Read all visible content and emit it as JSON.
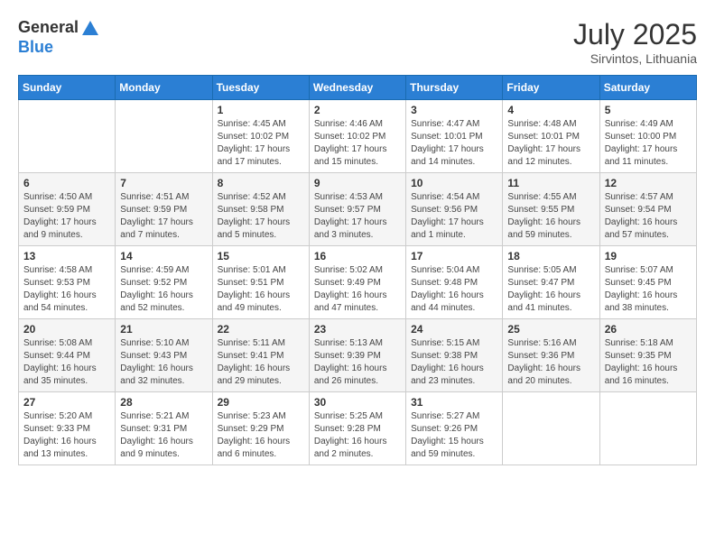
{
  "header": {
    "logo_general": "General",
    "logo_blue": "Blue",
    "month_title": "July 2025",
    "location": "Sirvintos, Lithuania"
  },
  "weekdays": [
    "Sunday",
    "Monday",
    "Tuesday",
    "Wednesday",
    "Thursday",
    "Friday",
    "Saturday"
  ],
  "weeks": [
    [
      {
        "day": "",
        "sunrise": "",
        "sunset": "",
        "daylight": ""
      },
      {
        "day": "",
        "sunrise": "",
        "sunset": "",
        "daylight": ""
      },
      {
        "day": "1",
        "sunrise": "Sunrise: 4:45 AM",
        "sunset": "Sunset: 10:02 PM",
        "daylight": "Daylight: 17 hours and 17 minutes."
      },
      {
        "day": "2",
        "sunrise": "Sunrise: 4:46 AM",
        "sunset": "Sunset: 10:02 PM",
        "daylight": "Daylight: 17 hours and 15 minutes."
      },
      {
        "day": "3",
        "sunrise": "Sunrise: 4:47 AM",
        "sunset": "Sunset: 10:01 PM",
        "daylight": "Daylight: 17 hours and 14 minutes."
      },
      {
        "day": "4",
        "sunrise": "Sunrise: 4:48 AM",
        "sunset": "Sunset: 10:01 PM",
        "daylight": "Daylight: 17 hours and 12 minutes."
      },
      {
        "day": "5",
        "sunrise": "Sunrise: 4:49 AM",
        "sunset": "Sunset: 10:00 PM",
        "daylight": "Daylight: 17 hours and 11 minutes."
      }
    ],
    [
      {
        "day": "6",
        "sunrise": "Sunrise: 4:50 AM",
        "sunset": "Sunset: 9:59 PM",
        "daylight": "Daylight: 17 hours and 9 minutes."
      },
      {
        "day": "7",
        "sunrise": "Sunrise: 4:51 AM",
        "sunset": "Sunset: 9:59 PM",
        "daylight": "Daylight: 17 hours and 7 minutes."
      },
      {
        "day": "8",
        "sunrise": "Sunrise: 4:52 AM",
        "sunset": "Sunset: 9:58 PM",
        "daylight": "Daylight: 17 hours and 5 minutes."
      },
      {
        "day": "9",
        "sunrise": "Sunrise: 4:53 AM",
        "sunset": "Sunset: 9:57 PM",
        "daylight": "Daylight: 17 hours and 3 minutes."
      },
      {
        "day": "10",
        "sunrise": "Sunrise: 4:54 AM",
        "sunset": "Sunset: 9:56 PM",
        "daylight": "Daylight: 17 hours and 1 minute."
      },
      {
        "day": "11",
        "sunrise": "Sunrise: 4:55 AM",
        "sunset": "Sunset: 9:55 PM",
        "daylight": "Daylight: 16 hours and 59 minutes."
      },
      {
        "day": "12",
        "sunrise": "Sunrise: 4:57 AM",
        "sunset": "Sunset: 9:54 PM",
        "daylight": "Daylight: 16 hours and 57 minutes."
      }
    ],
    [
      {
        "day": "13",
        "sunrise": "Sunrise: 4:58 AM",
        "sunset": "Sunset: 9:53 PM",
        "daylight": "Daylight: 16 hours and 54 minutes."
      },
      {
        "day": "14",
        "sunrise": "Sunrise: 4:59 AM",
        "sunset": "Sunset: 9:52 PM",
        "daylight": "Daylight: 16 hours and 52 minutes."
      },
      {
        "day": "15",
        "sunrise": "Sunrise: 5:01 AM",
        "sunset": "Sunset: 9:51 PM",
        "daylight": "Daylight: 16 hours and 49 minutes."
      },
      {
        "day": "16",
        "sunrise": "Sunrise: 5:02 AM",
        "sunset": "Sunset: 9:49 PM",
        "daylight": "Daylight: 16 hours and 47 minutes."
      },
      {
        "day": "17",
        "sunrise": "Sunrise: 5:04 AM",
        "sunset": "Sunset: 9:48 PM",
        "daylight": "Daylight: 16 hours and 44 minutes."
      },
      {
        "day": "18",
        "sunrise": "Sunrise: 5:05 AM",
        "sunset": "Sunset: 9:47 PM",
        "daylight": "Daylight: 16 hours and 41 minutes."
      },
      {
        "day": "19",
        "sunrise": "Sunrise: 5:07 AM",
        "sunset": "Sunset: 9:45 PM",
        "daylight": "Daylight: 16 hours and 38 minutes."
      }
    ],
    [
      {
        "day": "20",
        "sunrise": "Sunrise: 5:08 AM",
        "sunset": "Sunset: 9:44 PM",
        "daylight": "Daylight: 16 hours and 35 minutes."
      },
      {
        "day": "21",
        "sunrise": "Sunrise: 5:10 AM",
        "sunset": "Sunset: 9:43 PM",
        "daylight": "Daylight: 16 hours and 32 minutes."
      },
      {
        "day": "22",
        "sunrise": "Sunrise: 5:11 AM",
        "sunset": "Sunset: 9:41 PM",
        "daylight": "Daylight: 16 hours and 29 minutes."
      },
      {
        "day": "23",
        "sunrise": "Sunrise: 5:13 AM",
        "sunset": "Sunset: 9:39 PM",
        "daylight": "Daylight: 16 hours and 26 minutes."
      },
      {
        "day": "24",
        "sunrise": "Sunrise: 5:15 AM",
        "sunset": "Sunset: 9:38 PM",
        "daylight": "Daylight: 16 hours and 23 minutes."
      },
      {
        "day": "25",
        "sunrise": "Sunrise: 5:16 AM",
        "sunset": "Sunset: 9:36 PM",
        "daylight": "Daylight: 16 hours and 20 minutes."
      },
      {
        "day": "26",
        "sunrise": "Sunrise: 5:18 AM",
        "sunset": "Sunset: 9:35 PM",
        "daylight": "Daylight: 16 hours and 16 minutes."
      }
    ],
    [
      {
        "day": "27",
        "sunrise": "Sunrise: 5:20 AM",
        "sunset": "Sunset: 9:33 PM",
        "daylight": "Daylight: 16 hours and 13 minutes."
      },
      {
        "day": "28",
        "sunrise": "Sunrise: 5:21 AM",
        "sunset": "Sunset: 9:31 PM",
        "daylight": "Daylight: 16 hours and 9 minutes."
      },
      {
        "day": "29",
        "sunrise": "Sunrise: 5:23 AM",
        "sunset": "Sunset: 9:29 PM",
        "daylight": "Daylight: 16 hours and 6 minutes."
      },
      {
        "day": "30",
        "sunrise": "Sunrise: 5:25 AM",
        "sunset": "Sunset: 9:28 PM",
        "daylight": "Daylight: 16 hours and 2 minutes."
      },
      {
        "day": "31",
        "sunrise": "Sunrise: 5:27 AM",
        "sunset": "Sunset: 9:26 PM",
        "daylight": "Daylight: 15 hours and 59 minutes."
      },
      {
        "day": "",
        "sunrise": "",
        "sunset": "",
        "daylight": ""
      },
      {
        "day": "",
        "sunrise": "",
        "sunset": "",
        "daylight": ""
      }
    ]
  ]
}
